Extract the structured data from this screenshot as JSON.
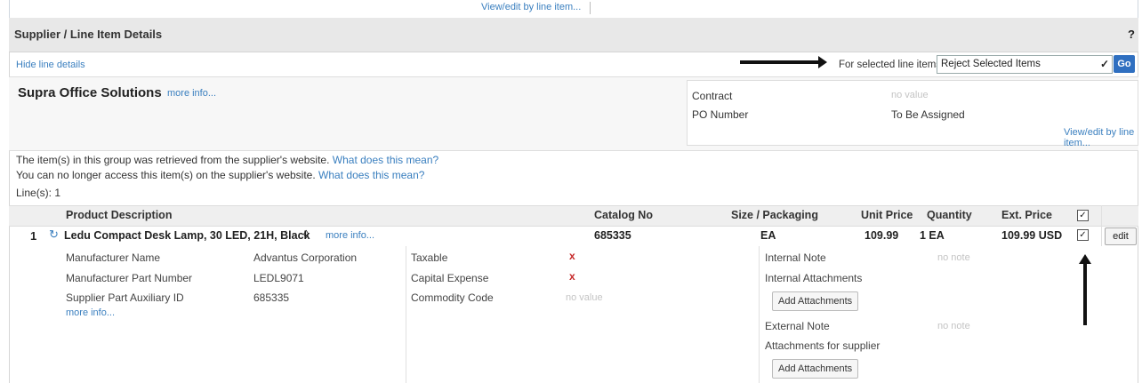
{
  "top": {
    "view_edit_link": "View/edit by line item..."
  },
  "section": {
    "title": "Supplier / Line Item Details",
    "help": "?"
  },
  "controls": {
    "hide_line_details": "Hide line details",
    "for_selected_label": "For selected line items",
    "action_selected": "Reject Selected Items",
    "go_label": "Go"
  },
  "supplier": {
    "name": "Supra Office Solutions",
    "more_info": "more info...",
    "contract_label": "Contract",
    "contract_value": "no value",
    "po_label": "PO Number",
    "po_value": "To Be Assigned",
    "view_edit_link": "View/edit by line item..."
  },
  "notices": {
    "line1_text": "The item(s) in this group was retrieved from the supplier's website.",
    "line1_link": "What does this mean?",
    "line2_text": "You can no longer access this item(s) on the supplier's website.",
    "line2_link": "What does this mean?",
    "lines_count": "Line(s): 1"
  },
  "table": {
    "headers": {
      "product": "Product Description",
      "catalog": "Catalog No",
      "size": "Size / Packaging",
      "unit_price": "Unit Price",
      "quantity": "Quantity",
      "ext_price": "Ext. Price"
    }
  },
  "item": {
    "line_no": "1",
    "title": "Ledu Compact Desk Lamp, 30 LED, 21H, Black",
    "more_info": "more info...",
    "catalog_no": "685335",
    "size": "EA",
    "unit_price": "109.99",
    "quantity": "1 EA",
    "ext_price": "109.99 USD",
    "edit_label": "edit",
    "details": {
      "manufacturer_name_label": "Manufacturer Name",
      "manufacturer_name": "Advantus Corporation",
      "mpn_label": "Manufacturer Part Number",
      "mpn": "LEDL9071",
      "aux_label": "Supplier Part Auxiliary ID",
      "aux": "685335",
      "more_info": "more info...",
      "taxable_label": "Taxable",
      "capital_label": "Capital Expense",
      "commodity_label": "Commodity Code",
      "commodity_value": "no value",
      "x_mark": "x",
      "internal_note_label": "Internal Note",
      "internal_note_value": "no note",
      "internal_attach_label": "Internal Attachments",
      "add_attachments": "Add Attachments",
      "external_note_label": "External Note",
      "external_note_value": "no note",
      "supplier_attach_label": "Attachments for supplier"
    }
  },
  "icons": {
    "check": "✓",
    "chevron": "✓",
    "refresh": "↻",
    "diamond": "◊"
  },
  "colors": {
    "link": "#3a7fbf",
    "go_button": "#2f6fc0",
    "reject_x": "#c62828"
  }
}
